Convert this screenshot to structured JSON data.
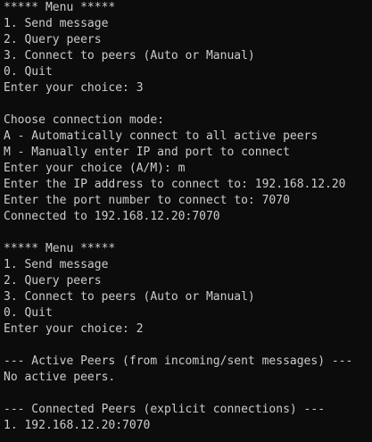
{
  "terminal": {
    "colors": {
      "background": "#0c0c0c",
      "foreground": "#cccccc"
    },
    "lines": [
      "***** Menu *****",
      "1. Send message",
      "2. Query peers",
      "3. Connect to peers (Auto or Manual)",
      "0. Quit",
      "Enter your choice: 3",
      "",
      "Choose connection mode:",
      "A - Automatically connect to all active peers",
      "M - Manually enter IP and port to connect",
      "Enter your choice (A/M): m",
      "Enter the IP address to connect to: 192.168.12.20",
      "Enter the port number to connect to: 7070",
      "Connected to 192.168.12.20:7070",
      "",
      "***** Menu *****",
      "1. Send message",
      "2. Query peers",
      "3. Connect to peers (Auto or Manual)",
      "0. Quit",
      "Enter your choice: 2",
      "",
      "--- Active Peers (from incoming/sent messages) ---",
      "No active peers.",
      "",
      "--- Connected Peers (explicit connections) ---",
      "1. 192.168.12.20:7070"
    ]
  }
}
